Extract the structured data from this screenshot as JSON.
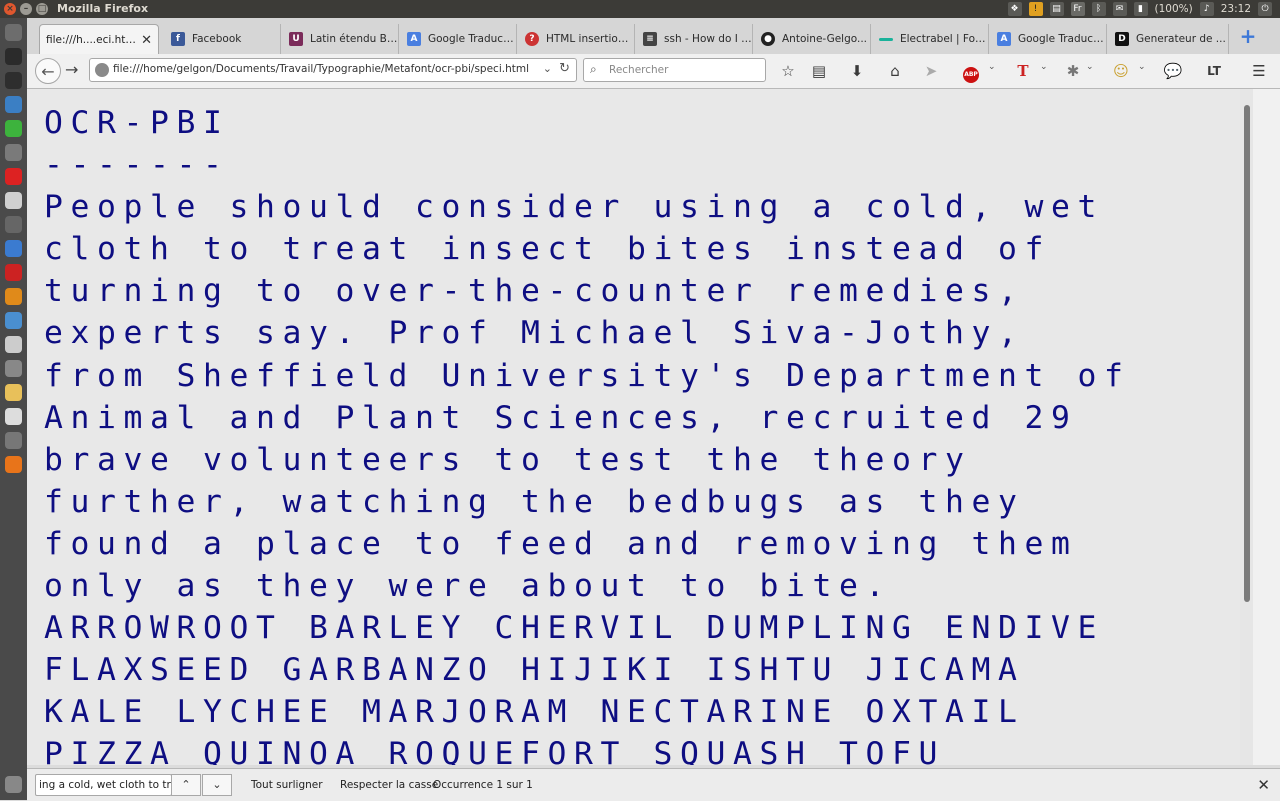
{
  "system": {
    "window_title": "Mozilla Firefox",
    "battery": "(100%)",
    "clock": "23:12",
    "keyboard_layout": "Fr"
  },
  "tabs": [
    {
      "label": "file:///h....eci.html",
      "favicon": "page-icon",
      "color": "#f4f4f4",
      "active": true
    },
    {
      "label": "Facebook",
      "favicon": "facebook-icon",
      "color": "#3b5998"
    },
    {
      "label": "Latin étendu B ...",
      "favicon": "unicode-icon",
      "color": "#7b2b5a"
    },
    {
      "label": "Google Traduct...",
      "favicon": "translate-icon",
      "color": "#4a7fe0"
    },
    {
      "label": "HTML insertion ...",
      "favicon": "quora-icon",
      "color": "#c33"
    },
    {
      "label": "ssh - How do I t...",
      "favicon": "stackoverflow-icon",
      "color": "#444"
    },
    {
      "label": "Antoine-Gelgo...",
      "favicon": "github-icon",
      "color": "#222"
    },
    {
      "label": "Electrabel | For...",
      "favicon": "electrabel-icon",
      "color": "#1ab29a"
    },
    {
      "label": "Google Traduct...",
      "favicon": "translate-icon",
      "color": "#4a7fe0"
    },
    {
      "label": "Generateur de ...",
      "favicon": "dj-icon",
      "color": "#111"
    }
  ],
  "nav": {
    "url": "file:///home/gelgon/Documents/Travail/Typographie/Metafont/ocr-pbi/speci.html",
    "search_placeholder": "Rechercher"
  },
  "page": {
    "text": "OCR-PBI\n-------\nPeople should consider using a cold, wet\ncloth to treat insect bites instead of\nturning to over-the-counter remedies,\nexperts say. Prof Michael Siva-Jothy,\nfrom Sheffield University's Department of\nAnimal and Plant Sciences, recruited 29\nbrave volunteers to test the theory\nfurther, watching the bedbugs as they\nfound a place to feed and removing them\nonly as they were about to bite.\nARROWROOT BARLEY CHERVIL DUMPLING ENDIVE\nFLAXSEED GARBANZO HIJIKI ISHTU JICAMA\nKALE LYCHEE MARJORAM NECTARINE OXTAIL\nPIZZA QUINOA ROQUEFORT SQUASH TOFU",
    "text_color": "#0e0e82"
  },
  "findbar": {
    "query": "ing a cold, wet cloth to treat",
    "highlight_all": "Tout surligner",
    "match_case": "Respecter la casse",
    "status": "Occurrence 1 sur 1"
  }
}
